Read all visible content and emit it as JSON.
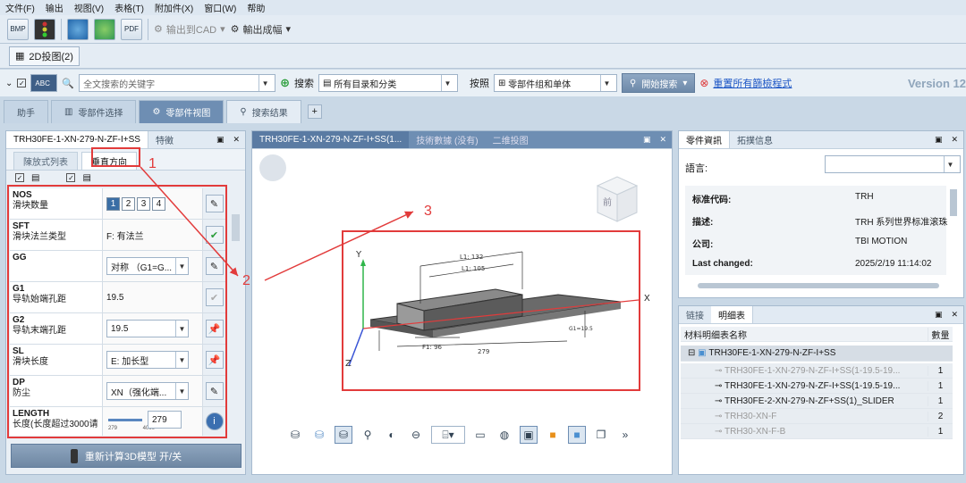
{
  "menu": [
    "文件(F)",
    "输出",
    "视图(V)",
    "表格(T)",
    "附加件(X)",
    "窗口(W)",
    "帮助"
  ],
  "toolbar": {
    "bmp": "BMP",
    "pdf": "PDF",
    "export_cad": "输出到CAD",
    "export_finished": "輸出成幅"
  },
  "view_tab": "2D投图(2)",
  "search": {
    "abc": "ABC",
    "placeholder": "全文搜索的关键字",
    "search_label": "搜索",
    "scope": "所有目录和分类",
    "by_label": "按照",
    "by_value": "零部件组和单体",
    "start_btn": "開始搜索",
    "reset_link": "重置所有篩檢程式"
  },
  "version": "Version 12",
  "main_tabs": [
    "助手",
    "零部件选择",
    "零部件视图",
    "搜索结果"
  ],
  "left_panel": {
    "tabs": [
      "TRH30FE-1-XN-279-N-ZF-I+SS",
      "特徵"
    ],
    "sub_tabs": [
      "陳放式列表",
      "垂直方向"
    ],
    "params": [
      {
        "code": "NOS",
        "name": "滑块数量",
        "value": ""
      },
      {
        "code": "SFT",
        "name": "滑块法兰类型",
        "value": "F: 有法兰"
      },
      {
        "code": "GG",
        "name": "",
        "value": "对称 （G1=G..."
      },
      {
        "code": "G1",
        "name": "导轨始端孔距",
        "value": "19.5"
      },
      {
        "code": "G2",
        "name": "导轨末端孔距",
        "value": "19.5"
      },
      {
        "code": "SL",
        "name": "滑块长度",
        "value": "E: 加长型"
      },
      {
        "code": "DP",
        "name": "防尘",
        "value": "XN（强化端..."
      },
      {
        "code": "LENGTH",
        "name": "长度(长度超过3000请",
        "value": "279"
      }
    ],
    "nos_options": [
      "1",
      "2",
      "3",
      "4"
    ],
    "slider_min": "279",
    "slider_max": "4000",
    "recalc": "重新计算3D模型 开/关"
  },
  "center_panel": {
    "tabs": [
      "TRH30FE-1-XN-279-N-ZF-I+SS(1...",
      "技術數據 (没有)",
      "二维投图"
    ],
    "cube_label": "前",
    "axis_x": "X",
    "axis_y": "Y",
    "axis_z": "Z",
    "dim_279": "279",
    "dim_l1": "L1: 132",
    "dim_l1b": "L1: 105",
    "dim_f1": "F1: 96",
    "dim_g": "G1=19.5"
  },
  "info_panel": {
    "tabs": [
      "零件資訊",
      "拓撲信息"
    ],
    "lang_label": "語言:",
    "rows": [
      {
        "label": "标准代码:",
        "value": "TRH"
      },
      {
        "label": "描述:",
        "value": "TRH 系列世界标准滚珠"
      },
      {
        "label": "公司:",
        "value": "TBI MOTION"
      },
      {
        "label": "Last changed:",
        "value": "2025/2/19 11:14:02"
      }
    ]
  },
  "bom_panel": {
    "tabs": [
      "链接",
      "明细表"
    ],
    "col_name": "材料明细表名称",
    "col_qty": "數量",
    "root": "TRH30FE-1-XN-279-N-ZF-I+SS",
    "rows": [
      {
        "name": "TRH30FE-1-XN-279-N-ZF-I+SS(1-19.5-19...",
        "qty": "1",
        "grey": true
      },
      {
        "name": "TRH30FE-1-XN-279-N-ZF-I+SS(1-19.5-19...",
        "qty": "1",
        "grey": false
      },
      {
        "name": "TRH30FE-2-XN-279-N-ZF+SS(1)_SLIDER",
        "qty": "1",
        "grey": false
      },
      {
        "name": "TRH30-XN-F",
        "qty": "2",
        "grey": true
      },
      {
        "name": "TRH30-XN-F-B",
        "qty": "1",
        "grey": true
      }
    ]
  },
  "annotations": [
    "1",
    "2",
    "3"
  ]
}
